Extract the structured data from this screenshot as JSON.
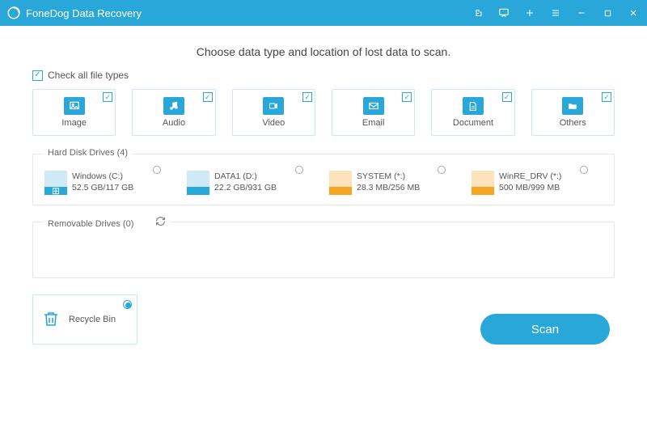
{
  "titlebar": {
    "app_name": "FoneDog Data Recovery"
  },
  "headline": "Choose data type and location of lost data to scan.",
  "check_all_label": "Check all file types",
  "types": [
    {
      "key": "image",
      "label": "Image"
    },
    {
      "key": "audio",
      "label": "Audio"
    },
    {
      "key": "video",
      "label": "Video"
    },
    {
      "key": "email",
      "label": "Email"
    },
    {
      "key": "document",
      "label": "Document"
    },
    {
      "key": "others",
      "label": "Others"
    }
  ],
  "hdd": {
    "title": "Hard Disk Drives (4)",
    "drives": [
      {
        "name": "Windows (C:)",
        "size": "52.5 GB/117 GB",
        "color": "#2aa7d9",
        "glyph": "⊞"
      },
      {
        "name": "DATA1 (D:)",
        "size": "22.2 GB/931 GB",
        "color": "#2aa7d9",
        "glyph": ""
      },
      {
        "name": "SYSTEM (*:)",
        "size": "28.3 MB/256 MB",
        "color": "#f5a623",
        "glyph": ""
      },
      {
        "name": "WinRE_DRV (*:)",
        "size": "500 MB/999 MB",
        "color": "#f5a623",
        "glyph": ""
      }
    ]
  },
  "removable": {
    "title": "Removable Drives (0)"
  },
  "recycle": {
    "label": "Recycle Bin"
  },
  "scan_label": "Scan"
}
